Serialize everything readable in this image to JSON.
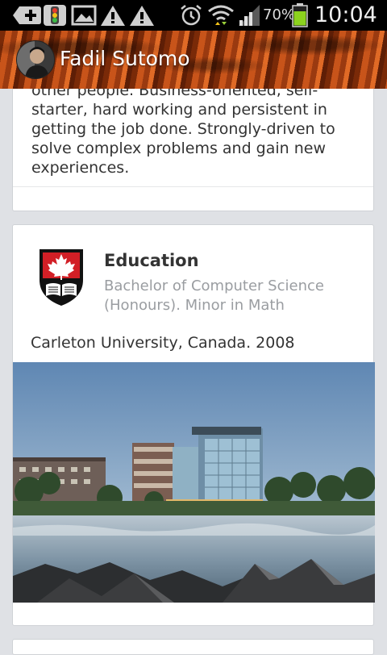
{
  "status_bar": {
    "battery_percent": "70%",
    "time": "10:04",
    "icons": [
      "add-icon",
      "traffic-light-icon",
      "image-icon",
      "warning-icon",
      "warning-icon",
      "alarm-icon",
      "wifi-icon",
      "signal-icon",
      "battery-icon"
    ]
  },
  "header": {
    "name": "Fadil Sutomo"
  },
  "summary_card": {
    "lines": [
      "other people. Business-oriented, self-",
      "starter, hard working and persistent in",
      "getting the job done. Strongly-driven to",
      "solve complex problems and gain new",
      "experiences."
    ]
  },
  "education_card": {
    "title": "Education",
    "degree": "Bachelor of Computer Science (Honours). Minor in Math",
    "school": "Carleton University, Canada. 2008"
  },
  "colors": {
    "background": "#dfe1e5",
    "card": "#ffffff",
    "shield_red": "#d21f26",
    "text_primary": "#333333",
    "text_secondary": "#9a9da1"
  }
}
